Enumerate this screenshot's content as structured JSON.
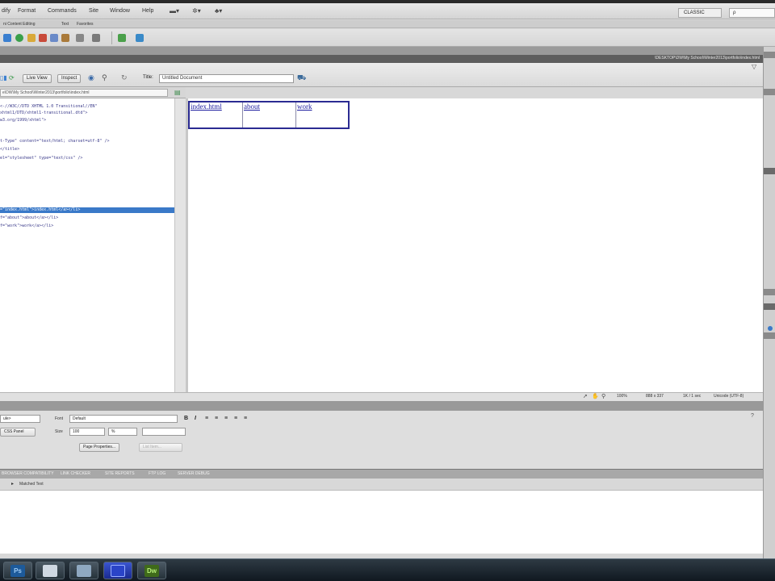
{
  "menubar": {
    "items": [
      "dify",
      "Format",
      "Commands",
      "Site",
      "Window",
      "Help"
    ],
    "workspace": "CLASSIC",
    "search_placeholder": "ρ"
  },
  "insert_bar": {
    "tabs": [
      "ni Content Editing",
      "Text",
      "Favorites"
    ]
  },
  "document": {
    "path": "\\DESKTOP\\DW\\My School\\Winter2013\\portfolio\\index.html",
    "live_view_label": "Live View",
    "inspect_label": "Inspect",
    "title_label": "Title:",
    "title_value": "Untitled Document",
    "address": "e\\DW\\My School\\Winter2013\\portfolio\\index.html"
  },
  "code_lines": [
    "<-//W3C//DTD XHTML 1.0 Transitional//EN\"",
    "xhtml1/DTD/xhtml1-transitional.dtd\">",
    "w3.org/1999/xhtml\">",
    "",
    "t-Type\" content=\"text/html; charset=utf-8\" />",
    "</title>",
    "el=\"stylesheet\" type=\"text/css\" />",
    "",
    "",
    "",
    "",
    "",
    "",
    "=\"index.html\">index.html</a></li>",
    "f=\"about\">about</a></li>",
    "f=\"work\">work</a></li>"
  ],
  "design": {
    "nav_links": [
      "index.html",
      "about",
      "work"
    ]
  },
  "statusbar": {
    "zoom": "100%",
    "size": "888 x 337",
    "weight": "1K / 1 sec",
    "encoding": "Unicode (UTF-8)"
  },
  "properties": {
    "format_value": "ule>",
    "font_label": "Font",
    "font_value": "Default",
    "size_label": "Size",
    "size_value": "100",
    "unit_value": "%",
    "css_panel_label": "CSS Panel",
    "page_props_label": "Page Properties...",
    "list_item_label": "List Item..."
  },
  "results": {
    "tabs": [
      "BROWSER COMPATIBILITY",
      "LINK CHECKER",
      "SITE REPORTS",
      "FTP LOG",
      "SERVER DEBUG"
    ],
    "subtitle": "Matched Text"
  },
  "taskbar": {
    "apps": [
      "Ps",
      "",
      "",
      "",
      "Dw"
    ]
  }
}
